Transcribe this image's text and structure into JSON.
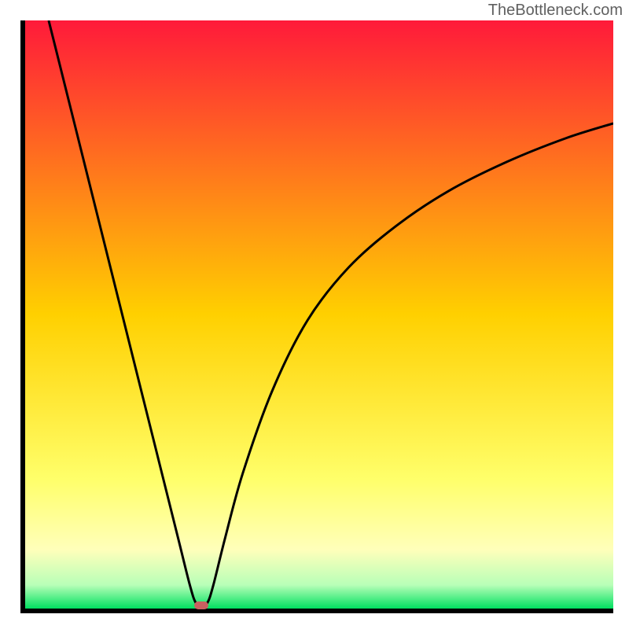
{
  "watermark": "TheBottleneck.com",
  "chart_data": {
    "type": "line",
    "title": "",
    "xlabel": "",
    "ylabel": "",
    "xlim": [
      0,
      100
    ],
    "ylim": [
      0,
      100
    ],
    "gradient_stops": [
      {
        "offset": 0,
        "color": "#ff1a3a"
      },
      {
        "offset": 50,
        "color": "#ffd000"
      },
      {
        "offset": 78,
        "color": "#ffff6a"
      },
      {
        "offset": 90,
        "color": "#ffffba"
      },
      {
        "offset": 96,
        "color": "#b8ffb8"
      },
      {
        "offset": 100,
        "color": "#00e060"
      }
    ],
    "curve": [
      {
        "x": 4.0,
        "y": 100.0
      },
      {
        "x": 5.0,
        "y": 96.0
      },
      {
        "x": 8.0,
        "y": 84.0
      },
      {
        "x": 12.0,
        "y": 68.0
      },
      {
        "x": 16.0,
        "y": 52.0
      },
      {
        "x": 20.0,
        "y": 36.0
      },
      {
        "x": 23.0,
        "y": 24.0
      },
      {
        "x": 26.0,
        "y": 12.0
      },
      {
        "x": 28.0,
        "y": 4.0
      },
      {
        "x": 29.0,
        "y": 1.0
      },
      {
        "x": 30.0,
        "y": 0.5
      },
      {
        "x": 31.0,
        "y": 1.0
      },
      {
        "x": 32.0,
        "y": 4.0
      },
      {
        "x": 34.0,
        "y": 12.0
      },
      {
        "x": 37.0,
        "y": 23.0
      },
      {
        "x": 42.0,
        "y": 37.0
      },
      {
        "x": 48.0,
        "y": 49.0
      },
      {
        "x": 55.0,
        "y": 58.0
      },
      {
        "x": 63.0,
        "y": 65.0
      },
      {
        "x": 72.0,
        "y": 71.0
      },
      {
        "x": 82.0,
        "y": 76.0
      },
      {
        "x": 92.0,
        "y": 80.0
      },
      {
        "x": 100.0,
        "y": 82.5
      }
    ],
    "marker": {
      "x": 30.0,
      "y": 0.5
    }
  }
}
